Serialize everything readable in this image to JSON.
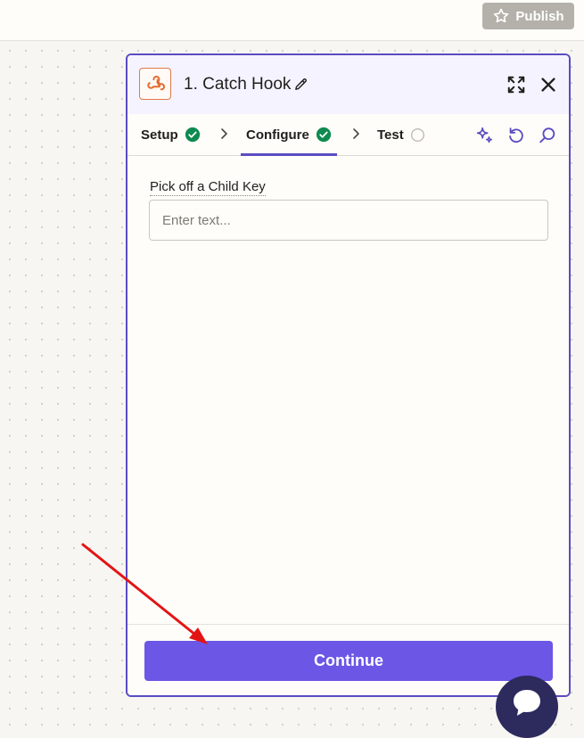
{
  "topbar": {
    "publish_label": "Publish",
    "publish_icon": "star-icon"
  },
  "panel": {
    "app_icon": "webhook-icon",
    "step_title": "1. Catch Hook",
    "header_icons": [
      "pencil-icon",
      "expand-icon",
      "close-icon"
    ],
    "tabs": [
      {
        "label": "Setup",
        "status": "complete"
      },
      {
        "label": "Configure",
        "status": "complete",
        "active": true
      },
      {
        "label": "Test",
        "status": "pending"
      }
    ],
    "toolbar_icons": [
      "sparkle-icon",
      "undo-icon",
      "search-icon"
    ],
    "field": {
      "label": "Pick off a Child Key",
      "value": "",
      "placeholder": "Enter text..."
    },
    "continue_label": "Continue"
  },
  "colors": {
    "accent": "#5a4cc2",
    "primary_button": "#6b56e6",
    "success": "#0f8a50",
    "brand_orange": "#e56a2e",
    "annotation_arrow": "#e31414"
  },
  "chat_widget": {
    "icon": "chat-icon"
  }
}
